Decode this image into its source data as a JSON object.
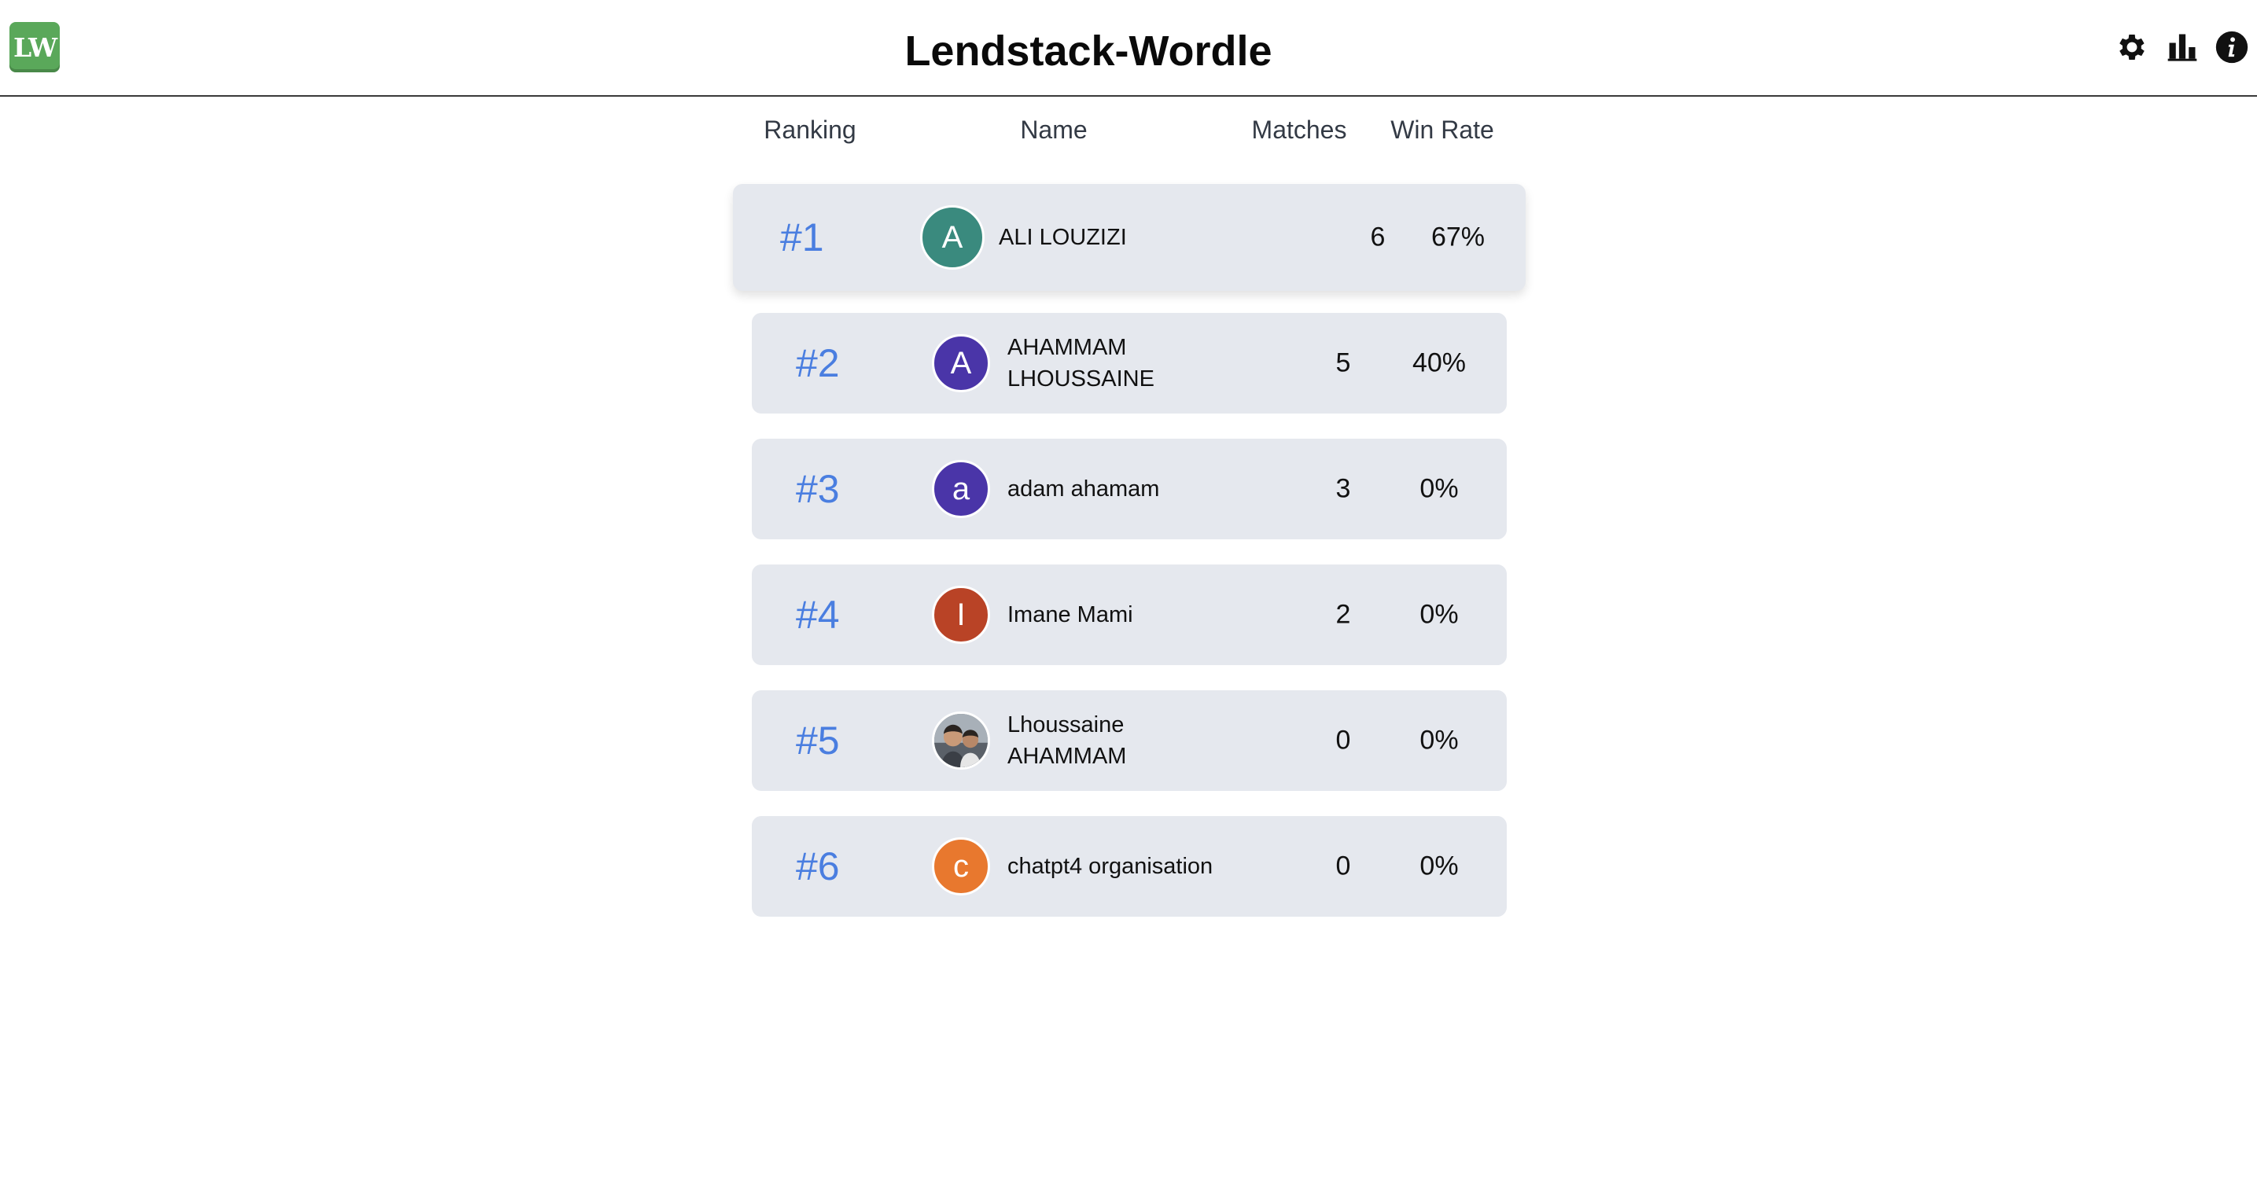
{
  "header": {
    "logo_text": "LW",
    "logo_color": "#5aa85a",
    "title": "Lendstack-Wordle",
    "icons": [
      "gear-icon",
      "bar-chart-icon",
      "info-icon"
    ]
  },
  "columns": {
    "ranking": "Ranking",
    "name": "Name",
    "matches": "Matches",
    "win_rate": "Win Rate"
  },
  "rows": [
    {
      "rank": "#1",
      "initial": "A",
      "avatar_color": "#3a8a7e",
      "name": "ALI LOUZIZI",
      "matches": "6",
      "win_rate": "67%"
    },
    {
      "rank": "#2",
      "initial": "A",
      "avatar_color": "#4a35a8",
      "name": "AHAMMAM LHOUSSAINE",
      "matches": "5",
      "win_rate": "40%"
    },
    {
      "rank": "#3",
      "initial": "a",
      "avatar_color": "#4a35a8",
      "name": "adam ahamam",
      "matches": "3",
      "win_rate": "0%"
    },
    {
      "rank": "#4",
      "initial": "I",
      "avatar_color": "#b94326",
      "name": "Imane Mami",
      "matches": "2",
      "win_rate": "0%"
    },
    {
      "rank": "#5",
      "initial": "",
      "avatar_color": "#8a8f96",
      "avatar_type": "photo",
      "name": "Lhoussaine AHAMMAM",
      "matches": "0",
      "win_rate": "0%"
    },
    {
      "rank": "#6",
      "initial": "c",
      "avatar_color": "#e8782e",
      "name": "chatpt4 organisation",
      "matches": "0",
      "win_rate": "0%"
    }
  ]
}
